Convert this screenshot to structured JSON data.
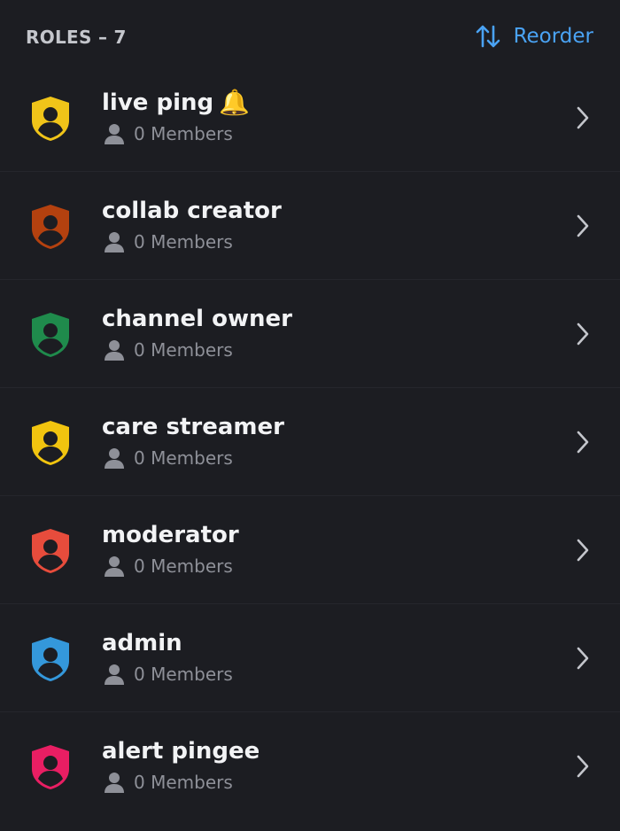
{
  "header": {
    "title": "ROLES – 7",
    "reorder_label": "Reorder",
    "reorder_icon": "sort-arrows-icon",
    "accent_color": "#4aa3f4"
  },
  "roles": [
    {
      "name": "live ping",
      "emoji": "🔔",
      "members": "0 Members",
      "color": "#f0c419"
    },
    {
      "name": "collab creator",
      "emoji": "",
      "members": "0 Members",
      "color": "#b4410f"
    },
    {
      "name": "channel owner",
      "emoji": "",
      "members": "0 Members",
      "color": "#1f8b4c"
    },
    {
      "name": "care streamer",
      "emoji": "",
      "members": "0 Members",
      "color": "#f1c40f"
    },
    {
      "name": "moderator",
      "emoji": "",
      "members": "0 Members",
      "color": "#e74c3c"
    },
    {
      "name": "admin",
      "emoji": "",
      "members": "0 Members",
      "color": "#3498db"
    },
    {
      "name": "alert pingee",
      "emoji": "",
      "members": "0 Members",
      "color": "#e91e63"
    }
  ],
  "icons": {
    "role": "role-shield-icon",
    "members": "person-icon",
    "chevron": "chevron-right-icon"
  }
}
